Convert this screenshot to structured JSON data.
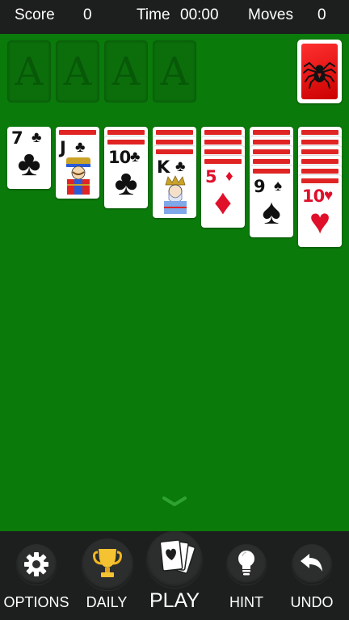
{
  "status": {
    "score_label": "Score",
    "score_value": "0",
    "time_label": "Time",
    "time_value": "00:00",
    "moves_label": "Moves",
    "moves_value": "0"
  },
  "foundations": [
    {
      "label": "A"
    },
    {
      "label": "A"
    },
    {
      "label": "A"
    },
    {
      "label": "A"
    }
  ],
  "stock": {
    "icon": "spider-icon"
  },
  "tableau": [
    {
      "face_down": 0,
      "card": {
        "rank": "7",
        "suit": "♣",
        "color": "black"
      }
    },
    {
      "face_down": 1,
      "card": {
        "rank": "J",
        "suit": "♣",
        "color": "black"
      }
    },
    {
      "face_down": 2,
      "card": {
        "rank": "10",
        "suit": "♣",
        "color": "black"
      }
    },
    {
      "face_down": 3,
      "card": {
        "rank": "K",
        "suit": "♣",
        "color": "black"
      }
    },
    {
      "face_down": 4,
      "card": {
        "rank": "5",
        "suit": "♦",
        "color": "red"
      }
    },
    {
      "face_down": 5,
      "card": {
        "rank": "9",
        "suit": "♠",
        "color": "black"
      }
    },
    {
      "face_down": 6,
      "card": {
        "rank": "10",
        "suit": "♥",
        "color": "red"
      }
    }
  ],
  "toolbar": {
    "options_label": "OPTIONS",
    "daily_label": "DAILY",
    "play_label": "PLAY",
    "hint_label": "HINT",
    "undo_label": "UNDO"
  },
  "colors": {
    "felt": "#0a7a0a",
    "bar": "#1d1f1f",
    "card_back": "#e02424",
    "red_suit": "#e0102a"
  }
}
